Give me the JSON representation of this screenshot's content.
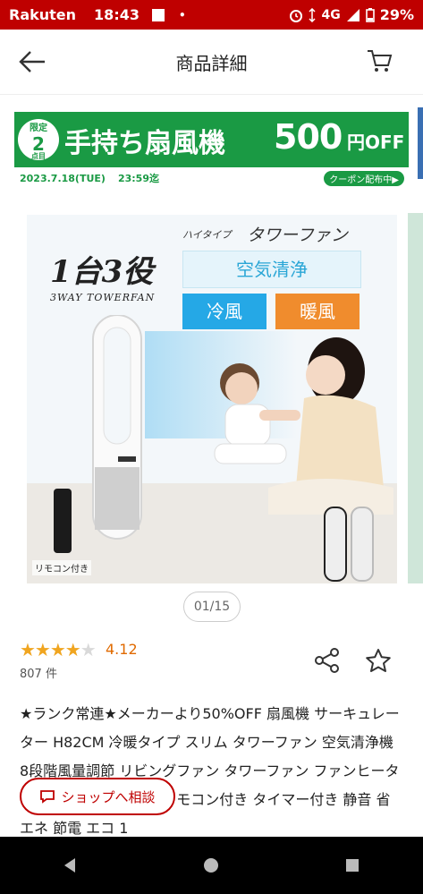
{
  "status_bar": {
    "carrier": "Rakuten",
    "time": "18:43",
    "dot": "•",
    "network": "4G",
    "battery": "29%"
  },
  "app_bar": {
    "title": "商品詳細"
  },
  "banner": {
    "badge_top": "限定",
    "badge_num": "2",
    "badge_unit": "点目",
    "headline": "手持ち扇風機",
    "amount": "500",
    "unit": "円OFF",
    "date": "2023.7.18(TUE)",
    "deadline": "23:59迄",
    "tag": "クーポン配布中▶"
  },
  "product_image": {
    "catch": "1台3役",
    "catch_sub": "3WAY TOWERFAN",
    "type_small": "ハイタイプ",
    "type_big": "タワーファン",
    "feature_1": "空気清浄",
    "feature_2": "冷風",
    "feature_3": "暖風",
    "remote_label": "リモコン付き"
  },
  "image_counter": "01/15",
  "rating": {
    "stars": "★★★★",
    "half": "★",
    "score": "4.12",
    "reviews": "807 件"
  },
  "description": "★ランク常連★メーカーより50%OFF 扇風機 サーキュレーター H82CM 冷暖タイプ スリム タワーファン 空気清浄機 8段階風量調節 リビングファン タワーファン ファンヒーター 羽なし 自動首振り リモコン付き タイマー付き 静音 省エネ 節電 エコ 1",
  "consult_button": "ショップへ相談",
  "colors": {
    "brand": "#bf0000",
    "banner_green": "#1a9a44",
    "star": "#f0a520",
    "score": "#e06a00"
  }
}
